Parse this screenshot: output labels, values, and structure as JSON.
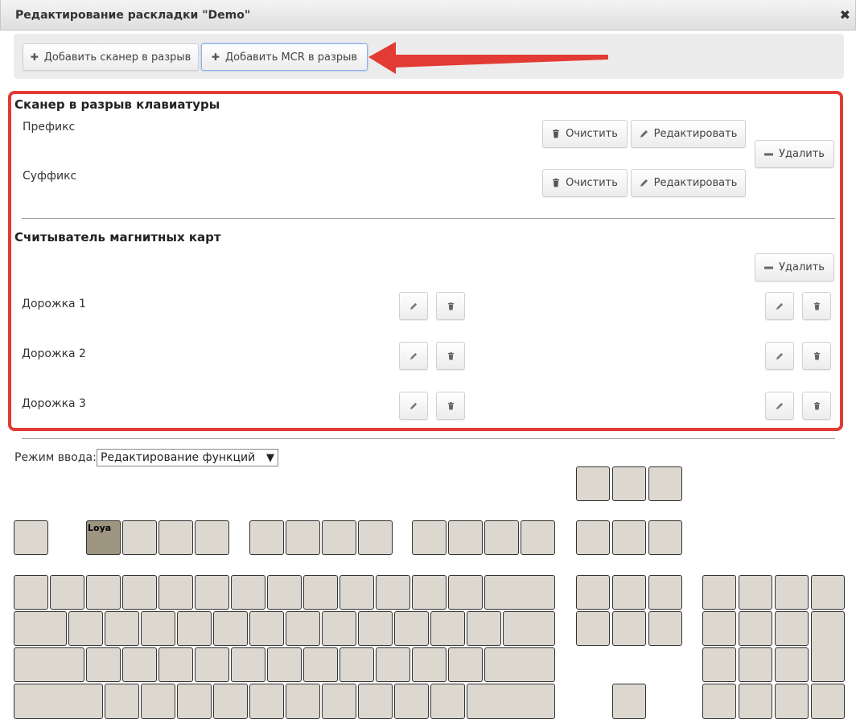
{
  "dialog": {
    "title": "Редактирование раскладки \"Demo\"",
    "close_icon": "close-icon",
    "close_glyph": "✖"
  },
  "toolbar": {
    "add_scanner_label": "Добавить сканер в разрыв",
    "add_mcr_label": "Добавить MCR в разрыв",
    "plus_glyph": "✚"
  },
  "annotation": {
    "arrow_color": "#e23b34",
    "frame_color": "#e23b34"
  },
  "scanner": {
    "heading": "Сканер в разрыв клавиатуры",
    "prefix_label": "Префикс",
    "suffix_label": "Суффикс",
    "clear_label": "Очистить",
    "edit_label": "Редактировать",
    "delete_label": "Удалить"
  },
  "mcr": {
    "heading": "Считыватель магнитных карт",
    "delete_label": "Удалить",
    "tracks": [
      "Дорожка 1",
      "Дорожка 2",
      "Дорожка 3"
    ]
  },
  "input_mode": {
    "label": "Режим ввода:",
    "selected": "Редактирование функций",
    "caret": "▼"
  },
  "keyboard": {
    "key_color": "#dcd8cf",
    "assigned_key_color": "#9d9580",
    "assigned_key_label": "Loya"
  }
}
